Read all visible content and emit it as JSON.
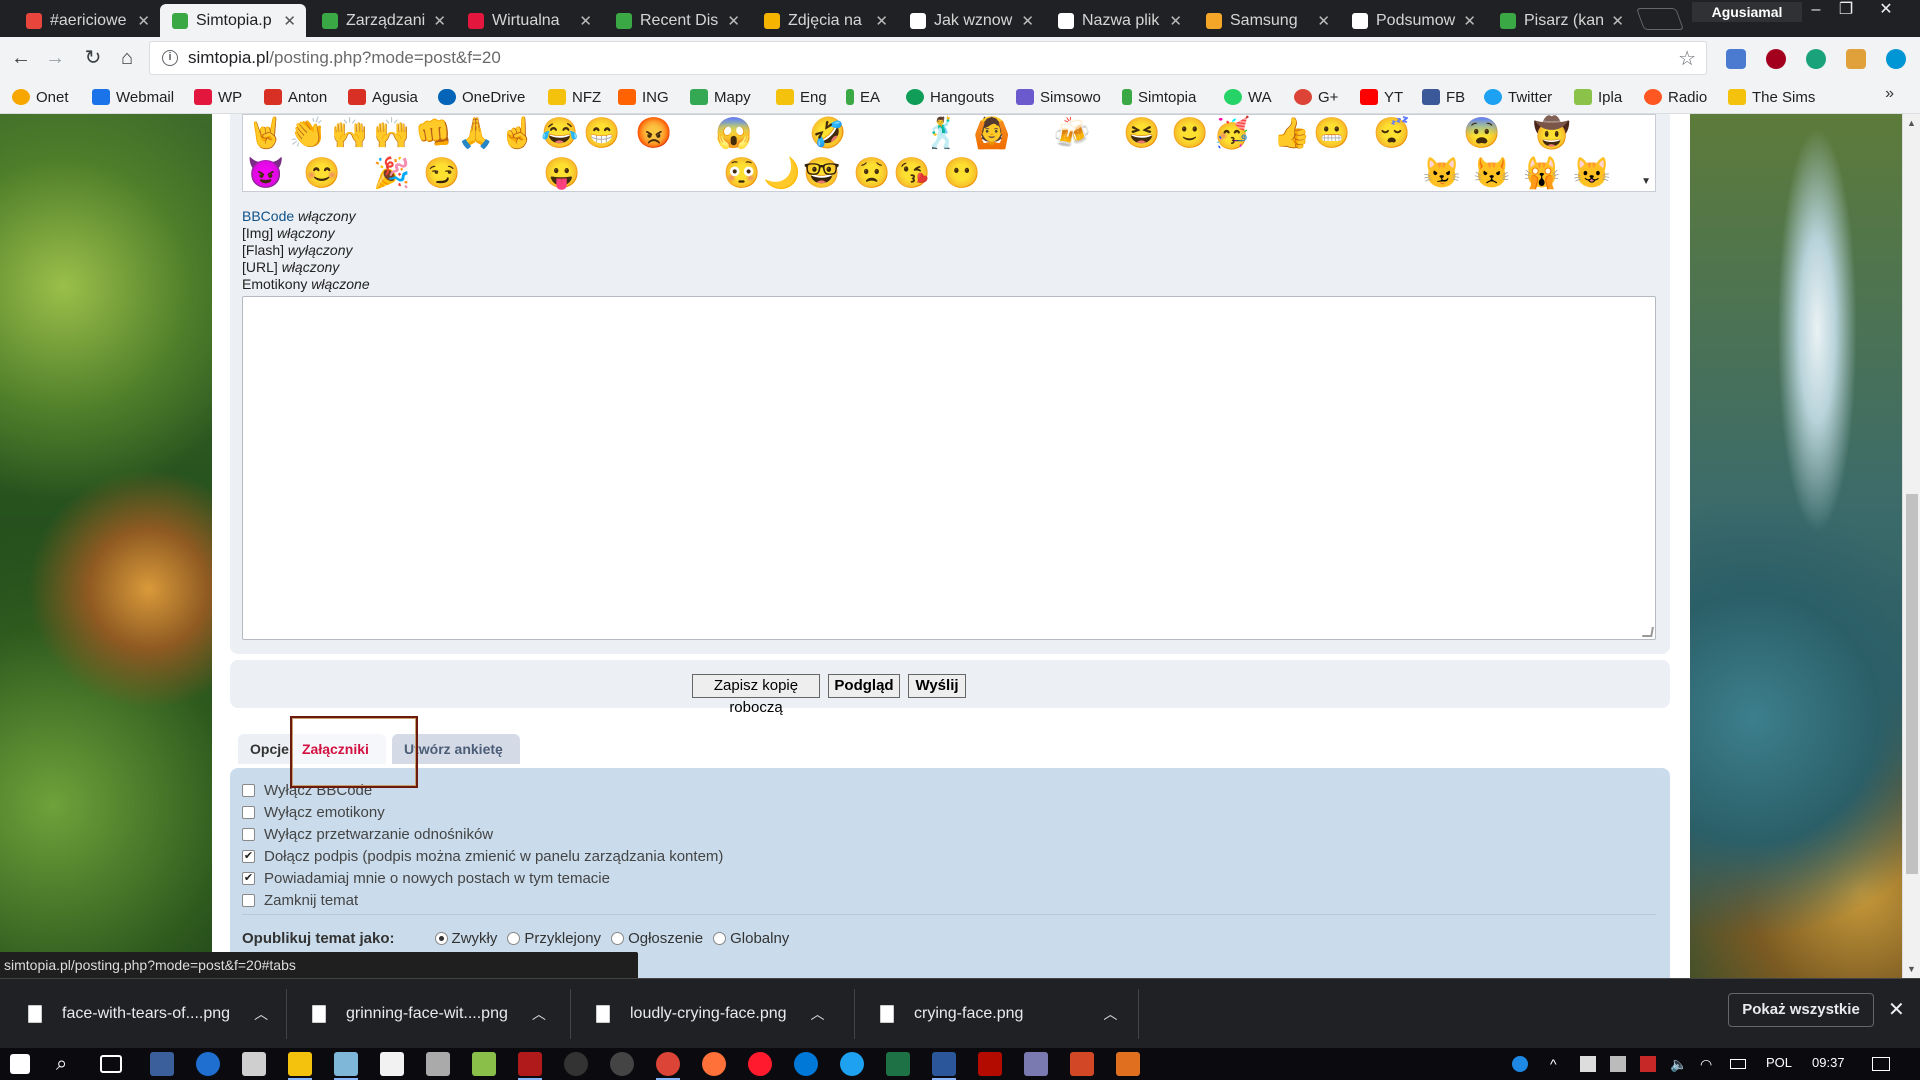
{
  "browser": {
    "tabs": [
      {
        "label": "#aericiowe",
        "icon_color": "#e8453c"
      },
      {
        "label": "Simtopia.p",
        "icon_color": "#39a845"
      },
      {
        "label": "Zarządzani",
        "icon_color": "#39a845"
      },
      {
        "label": "Wirtualna",
        "icon_color": "#e3173e"
      },
      {
        "label": "Recent Dis",
        "icon_color": "#39a845"
      },
      {
        "label": "Zdjęcia na",
        "icon_color": "#f4b400"
      },
      {
        "label": "Jak wznow",
        "icon_color": "#ffffff"
      },
      {
        "label": "Nazwa plik",
        "icon_color": "#ffffff"
      },
      {
        "label": "Samsung",
        "icon_color": "#f4a629"
      },
      {
        "label": "Podsumow",
        "icon_color": "#ffffff"
      },
      {
        "label": "Pisarz (kan",
        "icon_color": "#39a845"
      }
    ],
    "profile_name": "Agusiamal",
    "address": {
      "host": "simtopia.pl",
      "path": "/posting.php?mode=post&f=20"
    },
    "bookmarks": [
      {
        "label": "Onet",
        "color": "#f7a600"
      },
      {
        "label": "Webmail",
        "color": "#1a73e8"
      },
      {
        "label": "WP",
        "color": "#e3173e"
      },
      {
        "label": "Anton",
        "color": "#d93025"
      },
      {
        "label": "Agusia",
        "color": "#d93025"
      },
      {
        "label": "OneDrive",
        "color": "#0364b8"
      },
      {
        "label": "NFZ",
        "color": "#f4c20d"
      },
      {
        "label": "ING",
        "color": "#ff6200"
      },
      {
        "label": "Mapy",
        "color": "#34a853"
      },
      {
        "label": "Eng",
        "color": "#f4c20d"
      },
      {
        "label": "EA",
        "color": "#39a845"
      },
      {
        "label": "Hangouts",
        "color": "#0f9d58"
      },
      {
        "label": "Simsowo",
        "color": "#6a5acd"
      },
      {
        "label": "Simtopia",
        "color": "#39a845"
      },
      {
        "label": "WA",
        "color": "#25d366"
      },
      {
        "label": "G+",
        "color": "#db4437"
      },
      {
        "label": "YT",
        "color": "#ff0000"
      },
      {
        "label": "FB",
        "color": "#3b5998"
      },
      {
        "label": "Twitter",
        "color": "#1da1f2"
      },
      {
        "label": "Ipla",
        "color": "#8bc34a"
      },
      {
        "label": "Radio",
        "color": "#ff5722"
      },
      {
        "label": "The Sims",
        "color": "#f4c20d"
      }
    ]
  },
  "editor": {
    "bbcode": {
      "label": "BBCode",
      "state": "włączony"
    },
    "img": {
      "label": "[Img]",
      "state": "włączony"
    },
    "flash": {
      "label": "[Flash]",
      "state": "wyłączony"
    },
    "url": {
      "label": "[URL]",
      "state": "włączony"
    },
    "emoticons": {
      "label": "Emotikony",
      "state": "włączone"
    },
    "message": ""
  },
  "buttons": {
    "save_draft": "Zapisz kopię roboczą",
    "preview": "Podgląd",
    "submit": "Wyślij"
  },
  "option_tabs": [
    "Opcje",
    "Załączniki",
    "Utwórz ankietę"
  ],
  "options": [
    {
      "label": "Wyłącz BBCode",
      "checked": false
    },
    {
      "label": "Wyłącz emotikony",
      "checked": false
    },
    {
      "label": "Wyłącz przetwarzanie odnośników",
      "checked": false
    },
    {
      "label": "Dołącz podpis (podpis można zmienić w panelu zarządzania kontem)",
      "checked": true
    },
    {
      "label": "Powiadamiaj mnie o nowych postach w tym temacie",
      "checked": true
    },
    {
      "label": "Zamknij temat",
      "checked": false
    }
  ],
  "publish": {
    "label": "Opublikuj temat jako:",
    "choices": [
      {
        "label": "Zwykły",
        "selected": true
      },
      {
        "label": "Przyklejony",
        "selected": false
      },
      {
        "label": "Ogłoszenie",
        "selected": false
      },
      {
        "label": "Globalny",
        "selected": false
      }
    ]
  },
  "status_url": "simtopia.pl/posting.php?mode=post&f=20#tabs",
  "downloads": {
    "items": [
      "face-with-tears-of....png",
      "grinning-face-wit....png",
      "loudly-crying-face.png",
      "crying-face.png"
    ],
    "show_all": "Pokaż wszystkie"
  },
  "taskbar": {
    "language": "POL",
    "time": "09:37"
  }
}
